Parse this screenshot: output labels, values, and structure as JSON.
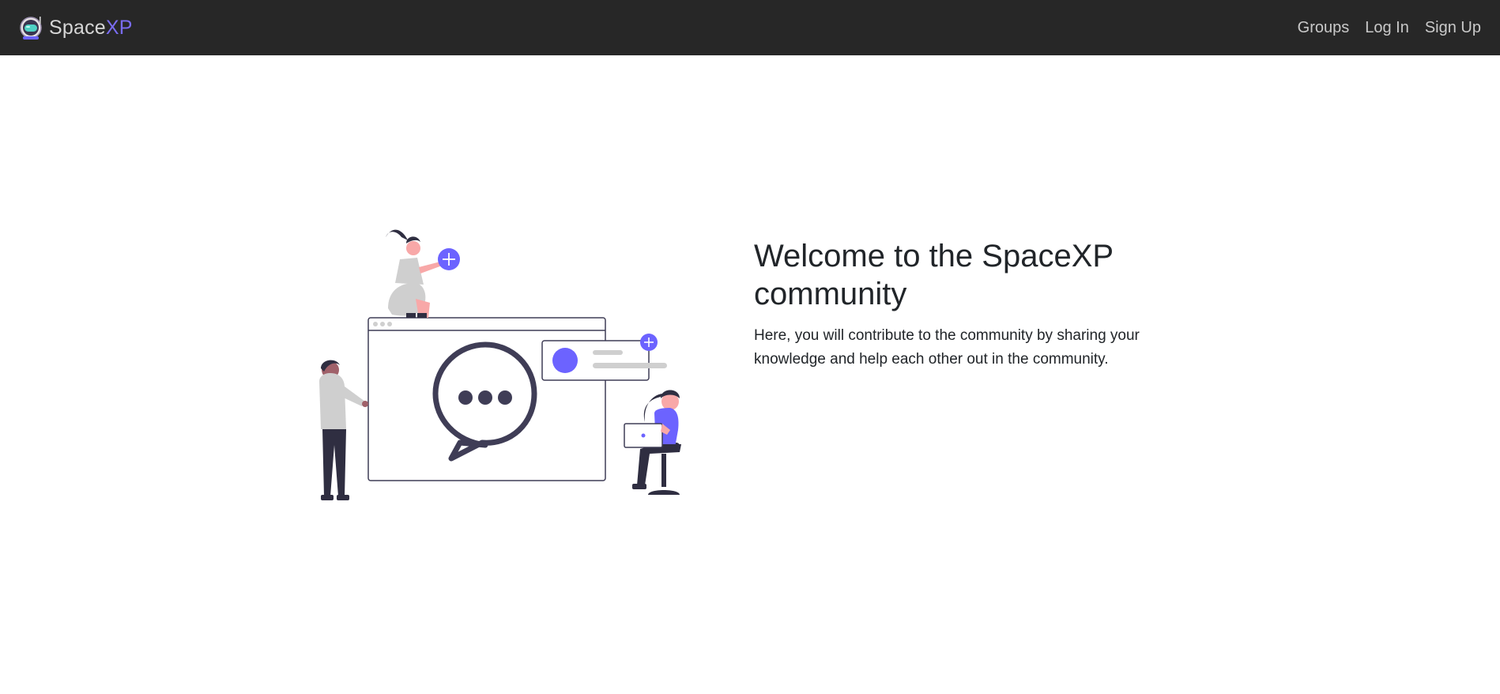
{
  "app": {
    "brand_prefix": "Space",
    "brand_suffix": "XP",
    "logo_icon": "astronaut-helmet-icon",
    "accent_color": "#6c63ff",
    "navbar_color": "#272727"
  },
  "nav": {
    "items": [
      {
        "label": "Groups"
      },
      {
        "label": "Log In"
      },
      {
        "label": "Sign Up"
      }
    ]
  },
  "hero": {
    "title": "Welcome to the SpaceXP community",
    "description": "Here, you will contribute to the community by sharing your knowledge and help each other out in the community.",
    "illustration": "community-chat-illustration"
  }
}
